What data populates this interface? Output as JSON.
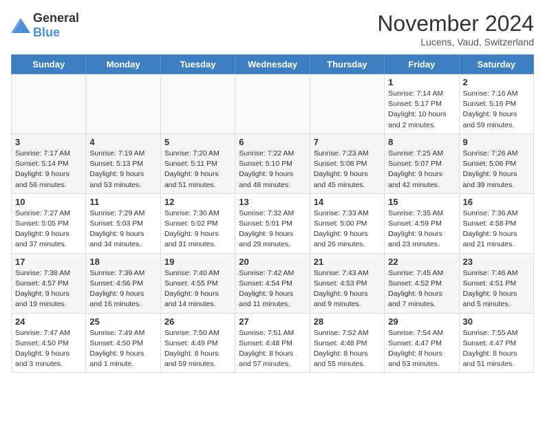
{
  "logo": {
    "general": "General",
    "blue": "Blue"
  },
  "title": "November 2024",
  "location": "Lucens, Vaud, Switzerland",
  "weekdays": [
    "Sunday",
    "Monday",
    "Tuesday",
    "Wednesday",
    "Thursday",
    "Friday",
    "Saturday"
  ],
  "weeks": [
    [
      {
        "day": "",
        "info": ""
      },
      {
        "day": "",
        "info": ""
      },
      {
        "day": "",
        "info": ""
      },
      {
        "day": "",
        "info": ""
      },
      {
        "day": "",
        "info": ""
      },
      {
        "day": "1",
        "info": "Sunrise: 7:14 AM\nSunset: 5:17 PM\nDaylight: 10 hours and 2 minutes."
      },
      {
        "day": "2",
        "info": "Sunrise: 7:16 AM\nSunset: 5:16 PM\nDaylight: 9 hours and 59 minutes."
      }
    ],
    [
      {
        "day": "3",
        "info": "Sunrise: 7:17 AM\nSunset: 5:14 PM\nDaylight: 9 hours and 56 minutes."
      },
      {
        "day": "4",
        "info": "Sunrise: 7:19 AM\nSunset: 5:13 PM\nDaylight: 9 hours and 53 minutes."
      },
      {
        "day": "5",
        "info": "Sunrise: 7:20 AM\nSunset: 5:11 PM\nDaylight: 9 hours and 51 minutes."
      },
      {
        "day": "6",
        "info": "Sunrise: 7:22 AM\nSunset: 5:10 PM\nDaylight: 9 hours and 48 minutes."
      },
      {
        "day": "7",
        "info": "Sunrise: 7:23 AM\nSunset: 5:08 PM\nDaylight: 9 hours and 45 minutes."
      },
      {
        "day": "8",
        "info": "Sunrise: 7:25 AM\nSunset: 5:07 PM\nDaylight: 9 hours and 42 minutes."
      },
      {
        "day": "9",
        "info": "Sunrise: 7:26 AM\nSunset: 5:06 PM\nDaylight: 9 hours and 39 minutes."
      }
    ],
    [
      {
        "day": "10",
        "info": "Sunrise: 7:27 AM\nSunset: 5:05 PM\nDaylight: 9 hours and 37 minutes."
      },
      {
        "day": "11",
        "info": "Sunrise: 7:29 AM\nSunset: 5:03 PM\nDaylight: 9 hours and 34 minutes."
      },
      {
        "day": "12",
        "info": "Sunrise: 7:30 AM\nSunset: 5:02 PM\nDaylight: 9 hours and 31 minutes."
      },
      {
        "day": "13",
        "info": "Sunrise: 7:32 AM\nSunset: 5:01 PM\nDaylight: 9 hours and 29 minutes."
      },
      {
        "day": "14",
        "info": "Sunrise: 7:33 AM\nSunset: 5:00 PM\nDaylight: 9 hours and 26 minutes."
      },
      {
        "day": "15",
        "info": "Sunrise: 7:35 AM\nSunset: 4:59 PM\nDaylight: 9 hours and 23 minutes."
      },
      {
        "day": "16",
        "info": "Sunrise: 7:36 AM\nSunset: 4:58 PM\nDaylight: 9 hours and 21 minutes."
      }
    ],
    [
      {
        "day": "17",
        "info": "Sunrise: 7:38 AM\nSunset: 4:57 PM\nDaylight: 9 hours and 19 minutes."
      },
      {
        "day": "18",
        "info": "Sunrise: 7:39 AM\nSunset: 4:56 PM\nDaylight: 9 hours and 16 minutes."
      },
      {
        "day": "19",
        "info": "Sunrise: 7:40 AM\nSunset: 4:55 PM\nDaylight: 9 hours and 14 minutes."
      },
      {
        "day": "20",
        "info": "Sunrise: 7:42 AM\nSunset: 4:54 PM\nDaylight: 9 hours and 11 minutes."
      },
      {
        "day": "21",
        "info": "Sunrise: 7:43 AM\nSunset: 4:53 PM\nDaylight: 9 hours and 9 minutes."
      },
      {
        "day": "22",
        "info": "Sunrise: 7:45 AM\nSunset: 4:52 PM\nDaylight: 9 hours and 7 minutes."
      },
      {
        "day": "23",
        "info": "Sunrise: 7:46 AM\nSunset: 4:51 PM\nDaylight: 9 hours and 5 minutes."
      }
    ],
    [
      {
        "day": "24",
        "info": "Sunrise: 7:47 AM\nSunset: 4:50 PM\nDaylight: 9 hours and 3 minutes."
      },
      {
        "day": "25",
        "info": "Sunrise: 7:49 AM\nSunset: 4:50 PM\nDaylight: 9 hours and 1 minute."
      },
      {
        "day": "26",
        "info": "Sunrise: 7:50 AM\nSunset: 4:49 PM\nDaylight: 8 hours and 59 minutes."
      },
      {
        "day": "27",
        "info": "Sunrise: 7:51 AM\nSunset: 4:48 PM\nDaylight: 8 hours and 57 minutes."
      },
      {
        "day": "28",
        "info": "Sunrise: 7:52 AM\nSunset: 4:48 PM\nDaylight: 8 hours and 55 minutes."
      },
      {
        "day": "29",
        "info": "Sunrise: 7:54 AM\nSunset: 4:47 PM\nDaylight: 8 hours and 53 minutes."
      },
      {
        "day": "30",
        "info": "Sunrise: 7:55 AM\nSunset: 4:47 PM\nDaylight: 8 hours and 51 minutes."
      }
    ]
  ]
}
